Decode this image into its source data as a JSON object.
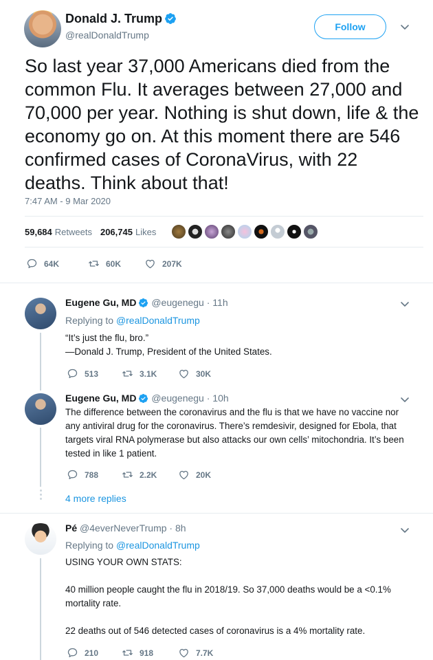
{
  "main_tweet": {
    "name": "Donald J. Trump",
    "handle": "@realDonaldTrump",
    "follow_label": "Follow",
    "text": "So last year 37,000 Americans died from the common Flu. It averages between 27,000 and 70,000 per year. Nothing is shut down, life & the economy go on. At this moment there are 546 confirmed cases of CoronaVirus, with 22 deaths. Think about that!",
    "timestamp": "7:47 AM - 9 Mar 2020",
    "retweets_count": "59,684",
    "retweets_label": "Retweets",
    "likes_count": "206,745",
    "likes_label": "Likes",
    "replies": "64K",
    "retweets": "60K",
    "likes": "207K"
  },
  "replies": [
    {
      "name": "Eugene Gu, MD",
      "handle": "@eugenegu",
      "time": "· 11h",
      "replying_prefix": "Replying to",
      "replying_to": "@realDonaldTrump",
      "line1": "“It’s just the flu, bro.”",
      "line2": "—Donald J. Trump, President of the United States.",
      "replies": "513",
      "retweets": "3.1K",
      "likes": "30K"
    },
    {
      "name": "Eugene Gu, MD",
      "handle": "@eugenegu",
      "time": "· 10h",
      "text": "The difference between the coronavirus and the flu is that we have no vaccine nor any antiviral drug for the coronavirus. There’s remdesivir, designed for Ebola, that targets viral RNA polymerase but also attacks our own cells’ mitochondria. It’s been tested in like 1 patient.",
      "replies": "788",
      "retweets": "2.2K",
      "likes": "20K",
      "more_replies": "4 more replies"
    },
    {
      "name": "Pé",
      "handle": "@4everNeverTrump",
      "time": "· 8h",
      "replying_prefix": "Replying to",
      "replying_to": "@realDonaldTrump",
      "p1": "USING YOUR OWN STATS:",
      "p2": "40 million people caught the flu in 2018/19. So 37,000 deaths would be a <0.1% mortality rate.",
      "p3": "22 deaths out of 546 detected cases of coronavirus is a 4% mortality rate.",
      "replies": "210",
      "retweets": "918",
      "likes": "7.7K"
    }
  ],
  "colors": {
    "accent": "#1da1f2",
    "link": "#1b95e0",
    "secondary_text": "#657786",
    "border": "#e6ecf0"
  },
  "icons": [
    "verified-badge-icon",
    "chevron-down-icon",
    "reply-icon",
    "retweet-icon",
    "like-icon"
  ]
}
